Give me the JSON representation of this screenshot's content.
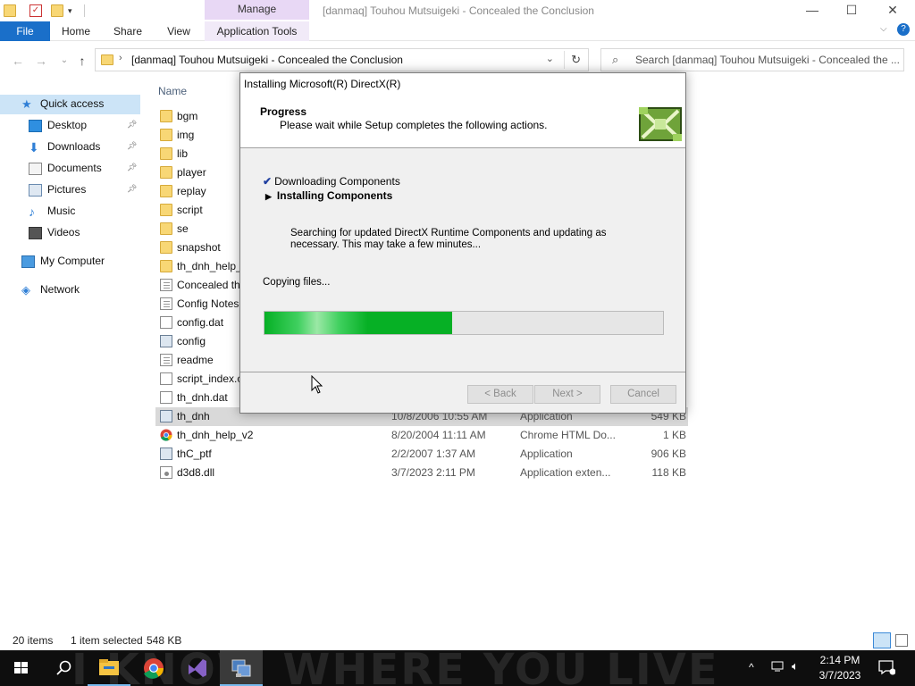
{
  "window": {
    "title": "[danmaq] Touhou Mutsuigeki - Concealed the Conclusion",
    "manage_tab": "Manage",
    "controls": {
      "minimize": "—",
      "maximize": "☐",
      "close": "✕"
    }
  },
  "ribbon": {
    "tabs": [
      "File",
      "Home",
      "Share",
      "View",
      "Application Tools"
    ]
  },
  "address": {
    "path": "[danmaq] Touhou Mutsuigeki - Concealed the Conclusion",
    "search_placeholder": "Search [danmaq] Touhou Mutsuigeki - Concealed the ..."
  },
  "sidebar": {
    "items": [
      {
        "label": "Quick access",
        "icon": "star-icon",
        "pinned": false,
        "selected": true
      },
      {
        "label": "Desktop",
        "icon": "desktop-icon",
        "pinned": true
      },
      {
        "label": "Downloads",
        "icon": "download-icon",
        "pinned": true
      },
      {
        "label": "Documents",
        "icon": "documents-icon",
        "pinned": true
      },
      {
        "label": "Pictures",
        "icon": "pictures-icon",
        "pinned": true
      },
      {
        "label": "Music",
        "icon": "music-icon",
        "pinned": false
      },
      {
        "label": "Videos",
        "icon": "videos-icon",
        "pinned": false
      },
      {
        "label": "My Computer",
        "icon": "computer-icon",
        "pinned": false
      },
      {
        "label": "Network",
        "icon": "network-icon",
        "pinned": false
      }
    ]
  },
  "filelist": {
    "column_name": "Name",
    "rows": [
      {
        "name": "bgm",
        "kind": "folder",
        "date": "",
        "type": "",
        "size": ""
      },
      {
        "name": "img",
        "kind": "folder",
        "date": "",
        "type": "",
        "size": ""
      },
      {
        "name": "lib",
        "kind": "folder",
        "date": "",
        "type": "",
        "size": ""
      },
      {
        "name": "player",
        "kind": "folder",
        "date": "",
        "type": "",
        "size": ""
      },
      {
        "name": "replay",
        "kind": "folder",
        "date": "",
        "type": "",
        "size": ""
      },
      {
        "name": "script",
        "kind": "folder",
        "date": "",
        "type": "",
        "size": ""
      },
      {
        "name": "se",
        "kind": "folder",
        "date": "",
        "type": "",
        "size": ""
      },
      {
        "name": "snapshot",
        "kind": "folder",
        "date": "",
        "type": "",
        "size": ""
      },
      {
        "name": "th_dnh_help_",
        "kind": "folder",
        "date": "",
        "type": "",
        "size": ""
      },
      {
        "name": "Concealed th",
        "kind": "text",
        "date": "",
        "type": "",
        "size": ""
      },
      {
        "name": "Config Notes",
        "kind": "text",
        "date": "",
        "type": "",
        "size": ""
      },
      {
        "name": "config.dat",
        "kind": "file",
        "date": "",
        "type": "",
        "size": ""
      },
      {
        "name": "config",
        "kind": "app",
        "date": "",
        "type": "",
        "size": ""
      },
      {
        "name": "readme",
        "kind": "text",
        "date": "",
        "type": "",
        "size": ""
      },
      {
        "name": "script_index.c",
        "kind": "file",
        "date": "",
        "type": "",
        "size": ""
      },
      {
        "name": "th_dnh.dat",
        "kind": "file",
        "date": "",
        "type": "",
        "size": ""
      },
      {
        "name": "th_dnh",
        "kind": "app",
        "date": "10/8/2006 10:55 AM",
        "type": "Application",
        "size": "549 KB",
        "selected": true
      },
      {
        "name": "th_dnh_help_v2",
        "kind": "chrome",
        "date": "8/20/2004 11:11 AM",
        "type": "Chrome HTML Do...",
        "size": "1 KB"
      },
      {
        "name": "thC_ptf",
        "kind": "app",
        "date": "2/2/2007 1:37 AM",
        "type": "Application",
        "size": "906 KB"
      },
      {
        "name": "d3d8.dll",
        "kind": "dll",
        "date": "3/7/2023 2:11 PM",
        "type": "Application exten...",
        "size": "118 KB"
      }
    ]
  },
  "statusbar": {
    "items_count": "20 items",
    "selection": "1 item selected",
    "selection_size": "548 KB"
  },
  "dialog": {
    "title": "Installing Microsoft(R) DirectX(R)",
    "header_title": "Progress",
    "header_subtitle": "Please wait while Setup completes the following actions.",
    "steps": [
      {
        "label": "Downloading Components",
        "state": "done",
        "marker": "✔"
      },
      {
        "label": "Installing Components",
        "state": "current",
        "marker": "▶"
      }
    ],
    "description": "Searching for updated DirectX Runtime Components and updating as necessary. This may take a few minutes...",
    "status": "Copying files...",
    "progress": 0.47,
    "buttons": {
      "back": "< Back",
      "next": "Next >",
      "cancel": "Cancel"
    }
  },
  "taskbar": {
    "wallpaper_text": "I KNOW WHERE YOU LIVE",
    "time": "2:14 PM",
    "date": "3/7/2023"
  },
  "colors": {
    "accent": "#1a6fc9",
    "manage_tab": "#e8d8f5",
    "progress_green": "#06b025",
    "selection": "#d9d9d9"
  }
}
